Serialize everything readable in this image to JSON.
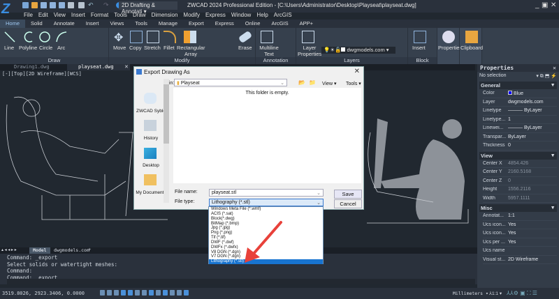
{
  "app": {
    "title": "ZWCAD 2024 Professional Edition - [C:\\Users\\Administrator\\Desktop\\Playseat\\playseat.dwg]",
    "workspace": "2D Drafting & Annotati"
  },
  "menu": [
    "File",
    "Edit",
    "View",
    "Insert",
    "Format",
    "Tools",
    "Draw",
    "Dimension",
    "Modify",
    "Express",
    "Window",
    "Help",
    "ArcGIS"
  ],
  "ribbon_tabs": [
    "Home",
    "Solid",
    "Annotate",
    "Insert",
    "Views",
    "Tools",
    "Manage",
    "Export",
    "Express",
    "Online",
    "ArcGIS",
    "APP+"
  ],
  "ribbon": {
    "draw": {
      "label": "Draw",
      "tools": [
        "Line",
        "Polyline",
        "Circle",
        "Arc"
      ]
    },
    "modify": {
      "label": "Modify",
      "tools": [
        "Move",
        "Copy",
        "Stretch",
        "Fillet",
        "Rectangular Array",
        "Erase"
      ]
    },
    "annotation": {
      "label": "Annotation",
      "tools": [
        "Multiline Text"
      ]
    },
    "layers": {
      "label": "Layers",
      "tools": [
        "Layer Properties"
      ],
      "current_layer": "dwgmodels.com"
    },
    "block": {
      "label": "Block",
      "tools": [
        "Insert"
      ]
    },
    "properties": {
      "label": "Properties"
    },
    "clipboard": {
      "label": "Clipboard"
    }
  },
  "doc_tabs": [
    "Drawing1.dwg",
    "playseat.dwg"
  ],
  "viewport_label": "[-][Top][2D Wireframe][WCS]",
  "layout_tabs": [
    "Model",
    "dwgmodels.com"
  ],
  "command_lines": [
    "Command: _export",
    "Select solids or watertight meshes:",
    "Command:",
    "Command: _export"
  ],
  "status": {
    "coords": "3519.8026, 2923.3406, 0.0000",
    "units": "Millimeters",
    "scale": "1:1"
  },
  "properties_panel": {
    "title": "Properties",
    "selection": "No selection",
    "sections": [
      {
        "name": "General",
        "rows": [
          [
            "Color",
            "Blue"
          ],
          [
            "Layer",
            "dwgmodels.com"
          ],
          [
            "Linetype",
            "ByLayer"
          ],
          [
            "Linetype...",
            "1"
          ],
          [
            "Linewei...",
            "ByLayer"
          ],
          [
            "Transpar...",
            "ByLayer"
          ],
          [
            "Thickness",
            "0"
          ]
        ]
      },
      {
        "name": "View",
        "rows": [
          [
            "Center X",
            "4854.426"
          ],
          [
            "Center Y",
            "2160.5168"
          ],
          [
            "Center Z",
            "0"
          ],
          [
            "Height",
            "1556.2116"
          ],
          [
            "Width",
            "5957.1111"
          ]
        ]
      },
      {
        "name": "Misc",
        "rows": [
          [
            "Annotat...",
            "1:1"
          ],
          [
            "Ucs icon...",
            "Yes"
          ],
          [
            "Ucs icon...",
            "Yes"
          ],
          [
            "Ucs per ...",
            "Yes"
          ],
          [
            "Ucs name",
            ""
          ],
          [
            "Visual st...",
            "2D Wireframe"
          ]
        ]
      }
    ]
  },
  "dialog": {
    "title": "Export Drawing As",
    "save_in_label": "Save in:",
    "save_in": "Playseat",
    "view": "View",
    "tools": "Tools",
    "empty_msg": "This folder is empty.",
    "places": [
      "ZWCAD Syble",
      "History",
      "Desktop",
      "My Documents"
    ],
    "file_name_label": "File name:",
    "file_name": "playseat.stl",
    "file_type_label": "File type:",
    "file_type": "Lithography (*.stl)",
    "save": "Save",
    "cancel": "Cancel",
    "file_type_options": [
      "Windows Meta File (*.wmf)",
      "ACIS (*.sat)",
      "Block(*.dwg)",
      "BitMap (*.bmp)",
      "Jpg (*.jpg)",
      "Png (*.png)",
      "Tif (*.tif)",
      "DWF (*.dwf)",
      "DWFx (*.dwfx)",
      "V8 DGN (*.dgn)",
      "V7 DGN (*.dgn)",
      "Lithography (*.stl)"
    ],
    "selected_index": 11
  },
  "colors": {
    "accent": "#1874d0",
    "annotation_arrow": "#e8413a",
    "layer_color": "#0000ff"
  }
}
